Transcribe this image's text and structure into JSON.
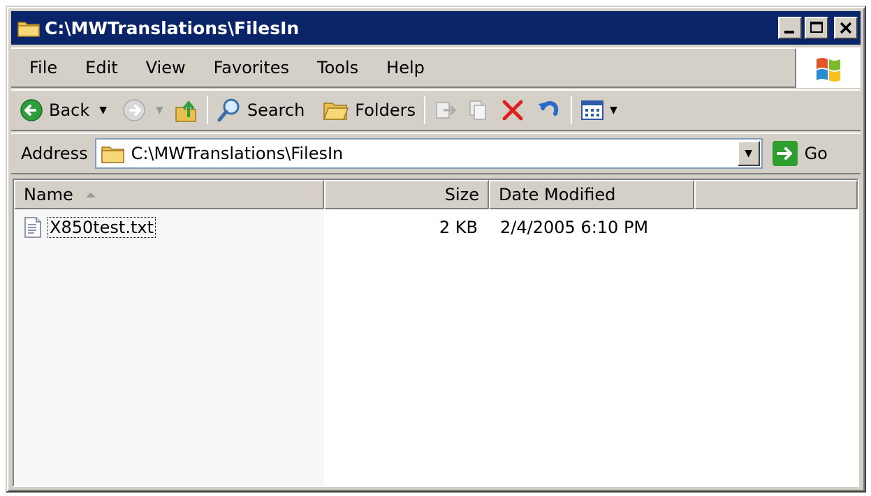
{
  "window": {
    "title": "C:\\MWTranslations\\FilesIn"
  },
  "menubar": {
    "items": [
      {
        "label": "File",
        "mnemonic": "F"
      },
      {
        "label": "Edit",
        "mnemonic": "E"
      },
      {
        "label": "View",
        "mnemonic": "V"
      },
      {
        "label": "Favorites",
        "mnemonic": "a"
      },
      {
        "label": "Tools",
        "mnemonic": "T"
      },
      {
        "label": "Help",
        "mnemonic": "H"
      }
    ]
  },
  "toolbar": {
    "back_label": "Back",
    "search_label": "Search",
    "folders_label": "Folders"
  },
  "addressbar": {
    "label": "Address",
    "value": "C:\\MWTranslations\\FilesIn",
    "go_label": "Go"
  },
  "listview": {
    "columns": [
      "Name",
      "Size",
      "Date Modified"
    ],
    "sort_column": "Name",
    "files": [
      {
        "name": "X850test.txt",
        "size": "2 KB",
        "date_modified": "2/4/2005 6:10 PM"
      }
    ]
  },
  "colors": {
    "titlebar": "#0a246a",
    "chrome": "#d4d0c8",
    "delete_red": "#e02020",
    "go_green": "#2e9e2e"
  }
}
